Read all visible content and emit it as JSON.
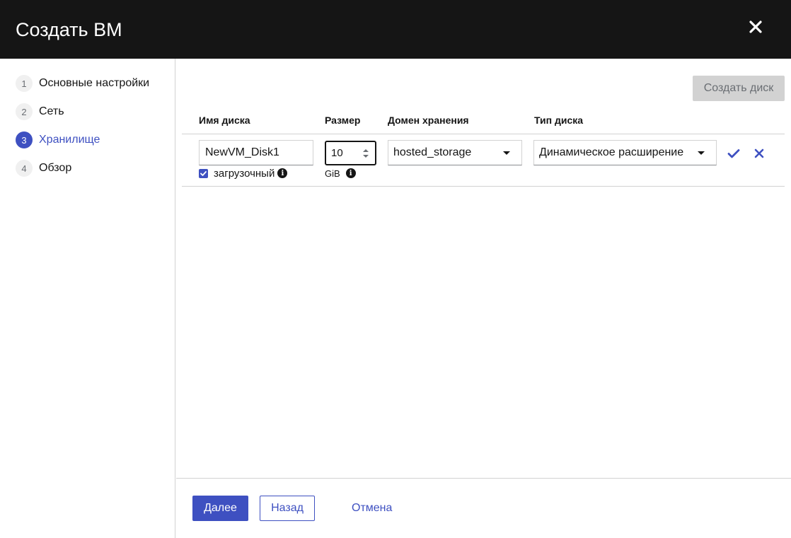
{
  "dialog": {
    "title": "Создать ВМ"
  },
  "wizard_steps": [
    {
      "number": "1",
      "label": "Основные настройки",
      "active": false
    },
    {
      "number": "2",
      "label": "Сеть",
      "active": false
    },
    {
      "number": "3",
      "label": "Хранилище",
      "active": true
    },
    {
      "number": "4",
      "label": "Обзор",
      "active": false
    }
  ],
  "storage": {
    "create_disk_label": "Создать диск",
    "columns": [
      "Имя диска",
      "Размер",
      "Домен хранения",
      "Тип диска"
    ],
    "disk": {
      "name": "NewVM_Disk1",
      "size": "10",
      "size_unit": "GiB",
      "bootable_label": "загрузочный",
      "bootable_checked": true,
      "storage_domain": "hosted_storage",
      "disk_type": "Динамическое расширение"
    }
  },
  "footer": {
    "next_label": "Далее",
    "back_label": "Назад",
    "cancel_label": "Отмена"
  },
  "colors": {
    "header_bg": "#151515",
    "accent": "#3e50c1",
    "disabled_bg": "#d2d2d2"
  },
  "icons": {
    "close": "close-icon",
    "info": "info-icon",
    "confirm": "check-icon",
    "remove": "close-icon",
    "dropdown": "caret-down-icon"
  }
}
